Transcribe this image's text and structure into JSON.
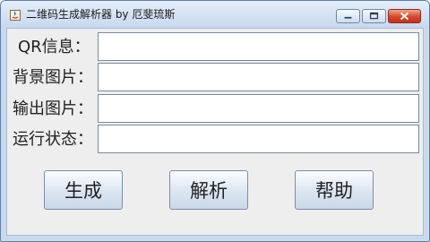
{
  "window": {
    "title": "二维码生成解析器 by 厄斐琉斯",
    "icon": "java-app-icon",
    "controls": [
      "minimize-icon",
      "maximize-icon",
      "close-icon"
    ]
  },
  "form": {
    "fields": [
      {
        "label": "QR信息：",
        "value": "",
        "placeholder": ""
      },
      {
        "label": "背景图片：",
        "value": "",
        "placeholder": ""
      },
      {
        "label": "输出图片：",
        "value": "",
        "placeholder": ""
      },
      {
        "label": "运行状态：",
        "value": "",
        "placeholder": ""
      }
    ]
  },
  "buttons": {
    "generate": "生成",
    "parse": "解析",
    "help": "帮助"
  },
  "colors": {
    "window_bg": "#eeeeee",
    "title_gradient_top": "#e4eefa",
    "close_button": "#d6472e"
  }
}
